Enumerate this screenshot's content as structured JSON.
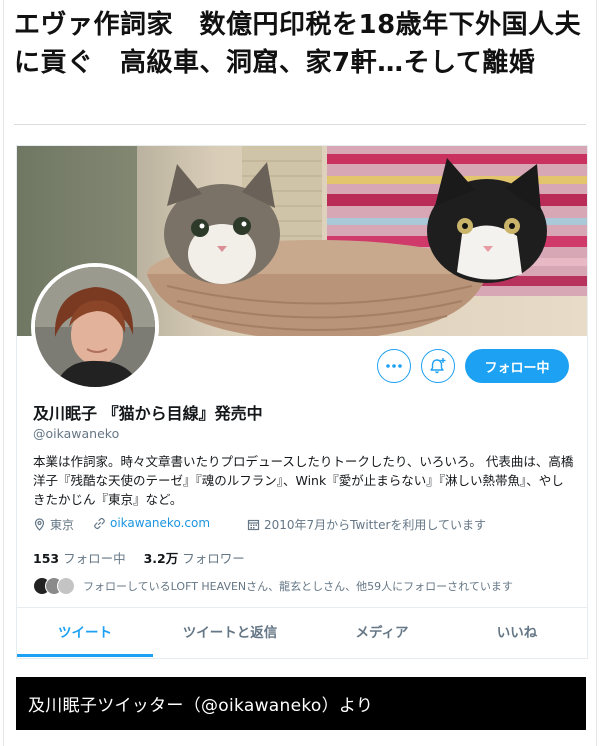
{
  "article": {
    "headline": "エヴァ作詞家　数億円印税を18歳年下外国人夫に貢ぐ　高級車、洞窟、家7軒…そして離婚",
    "caption": "及川眠子ツイッター（@oikawaneko）より"
  },
  "profile": {
    "display_name": "及川眠子 『猫から目線』発売中",
    "handle": "@oikawaneko",
    "bio": "本業は作詞家。時々文章書いたりプロデュースしたりトークしたり、いろいろ。 代表曲は、高橋洋子『残酷な天使のテーゼ』『魂のルフラン』、Wink『愛が止まらない』『淋しい熱帯魚』、やしきたかじん『東京』など。",
    "location": "東京",
    "website": "oikawaneko.com",
    "joined": "2010年7月からTwitterを利用しています",
    "following_count": "153",
    "following_label": "フォロー中",
    "followers_count": "3.2万",
    "followers_label": "フォロワー",
    "known_followers": "フォローしているLOFT HEAVENさん、龍玄としさん、他59人にフォローされています"
  },
  "actions": {
    "more_icon": "more-dots-icon",
    "notify_icon": "bell-plus-icon",
    "follow_label": "フォロー中"
  },
  "tabs": [
    "ツイート",
    "ツイートと返信",
    "メディア",
    "いいね"
  ],
  "colors": {
    "accent": "#1da1f2",
    "link": "#1b95e0",
    "muted_text": "#657786",
    "caption_bg": "#000000"
  }
}
